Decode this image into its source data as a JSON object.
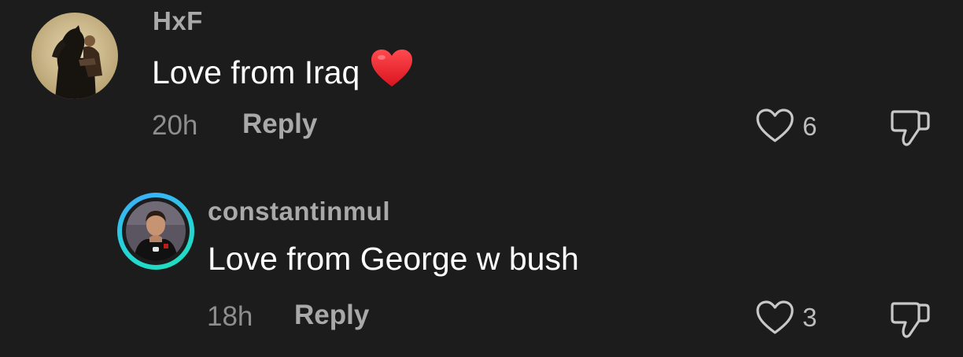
{
  "comments": [
    {
      "username": "HxF",
      "text": "Love from Iraq",
      "emoji": "red-heart",
      "time": "20h",
      "reply_label": "Reply",
      "likes": "6"
    },
    {
      "username": "constantinmul",
      "text": "Love from George w bush",
      "time": "18h",
      "reply_label": "Reply",
      "likes": "3",
      "avatar_ring": true
    }
  ],
  "colors": {
    "background": "#1c1c1c",
    "username": "#a9a9a9",
    "text": "#ffffff",
    "time": "#8e8e8e",
    "heart_emoji": "#e8202a",
    "ring_start": "#3fa9ff",
    "ring_end": "#1ee0b8"
  },
  "icons": {
    "like": "heart-outline-icon",
    "dislike": "thumbs-down-icon"
  }
}
